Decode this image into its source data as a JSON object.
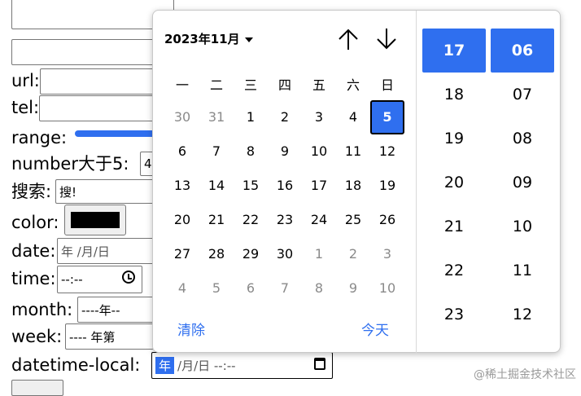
{
  "form": {
    "labels": {
      "url": "url:",
      "tel": "tel:",
      "range": "range:",
      "number": "number大于5:",
      "search": "搜索:",
      "color": "color:",
      "date": "date:",
      "time": "time:",
      "month": "month:",
      "week": "week:",
      "datetime_local": "datetime-local:"
    },
    "number_value": "4",
    "search_value": "搜!",
    "color_value": "#000000",
    "date_placeholder": " 年 /月/日",
    "time_placeholder": "--:--",
    "month_placeholder": "----年--",
    "week_placeholder": "---- 年第",
    "datetime": {
      "year": "年",
      "rest": "/月/日  --:--"
    }
  },
  "picker": {
    "month_title": "2023年11月",
    "weekdays": [
      "一",
      "二",
      "三",
      "四",
      "五",
      "六",
      "日"
    ],
    "weeks": [
      [
        {
          "d": "30",
          "o": true
        },
        {
          "d": "31",
          "o": true
        },
        {
          "d": "1"
        },
        {
          "d": "2"
        },
        {
          "d": "3"
        },
        {
          "d": "4"
        },
        {
          "d": "5",
          "sel": true
        }
      ],
      [
        {
          "d": "6"
        },
        {
          "d": "7"
        },
        {
          "d": "8"
        },
        {
          "d": "9"
        },
        {
          "d": "10"
        },
        {
          "d": "11"
        },
        {
          "d": "12"
        }
      ],
      [
        {
          "d": "13"
        },
        {
          "d": "14"
        },
        {
          "d": "15"
        },
        {
          "d": "16"
        },
        {
          "d": "17"
        },
        {
          "d": "18"
        },
        {
          "d": "19"
        }
      ],
      [
        {
          "d": "20"
        },
        {
          "d": "21"
        },
        {
          "d": "22"
        },
        {
          "d": "23"
        },
        {
          "d": "24"
        },
        {
          "d": "25"
        },
        {
          "d": "26"
        }
      ],
      [
        {
          "d": "27"
        },
        {
          "d": "28"
        },
        {
          "d": "29"
        },
        {
          "d": "30"
        },
        {
          "d": "1",
          "o": true
        },
        {
          "d": "2",
          "o": true
        },
        {
          "d": "3",
          "o": true
        }
      ],
      [
        {
          "d": "4",
          "o": true
        },
        {
          "d": "5",
          "o": true
        },
        {
          "d": "6",
          "o": true
        },
        {
          "d": "7",
          "o": true
        },
        {
          "d": "8",
          "o": true
        },
        {
          "d": "9",
          "o": true
        },
        {
          "d": "10",
          "o": true
        }
      ]
    ],
    "clear_label": "清除",
    "today_label": "今天",
    "hours": [
      "17",
      "18",
      "19",
      "20",
      "21",
      "22",
      "23"
    ],
    "minutes": [
      "06",
      "07",
      "08",
      "09",
      "10",
      "11",
      "12"
    ],
    "selected_hour": "17",
    "selected_minute": "06",
    "accent_color": "#2f6fef"
  },
  "watermark": "@稀土掘金技术社区"
}
